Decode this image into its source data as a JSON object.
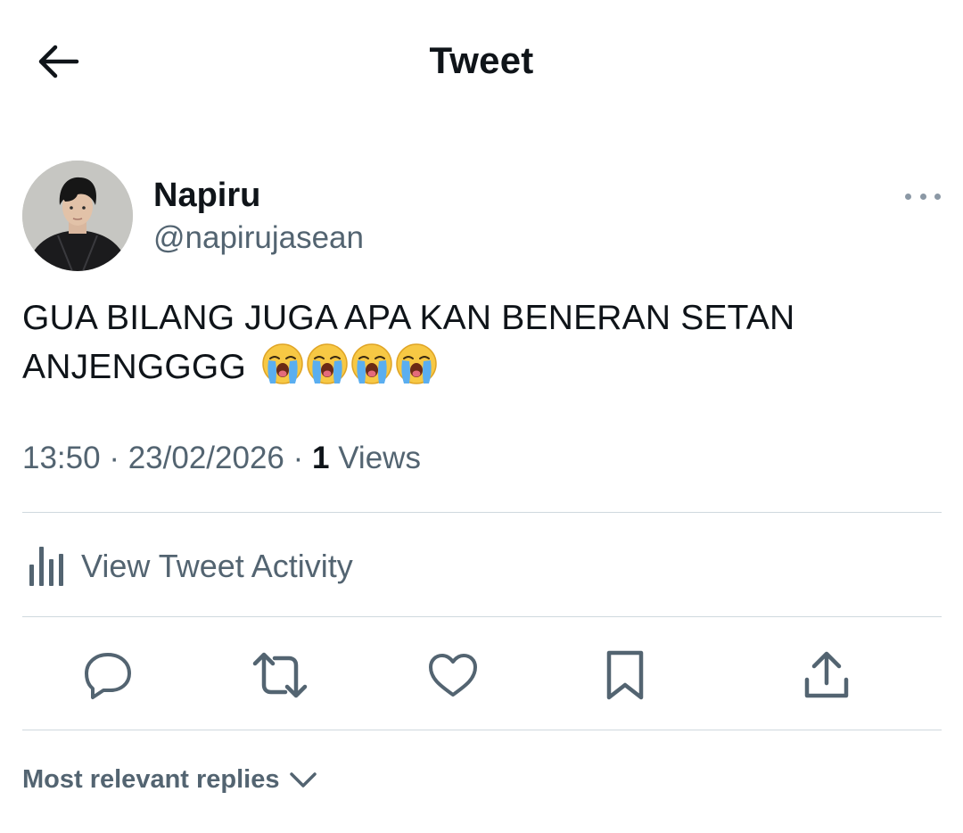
{
  "header": {
    "title": "Tweet",
    "back_icon": "arrow-left-icon"
  },
  "author": {
    "display_name": "Napiru",
    "handle": "@napirujasean"
  },
  "tweet": {
    "text": "GUA BILANG JUGA APA KAN BENERAN SETAN ANJENGGGG",
    "emoji": "😭😭😭😭",
    "emoji_icon": "loudly-crying-face-icon",
    "time": "13:50",
    "date": "23/02/2026",
    "separator": "·",
    "views_count": "1",
    "views_label": "Views"
  },
  "activity": {
    "label": "View Tweet Activity",
    "icon": "bar-chart-icon"
  },
  "actions": {
    "icons": [
      "reply-icon",
      "retweet-icon",
      "like-icon",
      "bookmark-icon",
      "share-icon"
    ]
  },
  "replies": {
    "sort_label": "Most relevant replies"
  },
  "colors": {
    "text_primary": "#0f1419",
    "text_secondary": "#536471",
    "divider": "#cfd9de"
  }
}
